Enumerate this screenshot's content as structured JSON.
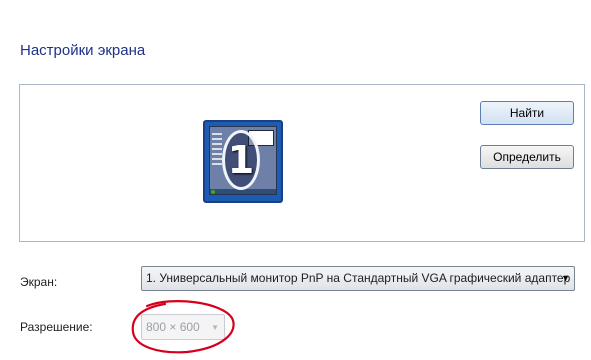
{
  "header": {
    "title": "Настройки экрана"
  },
  "preview": {
    "monitor_number": "1",
    "find_button": "Найти",
    "identify_button": "Определить"
  },
  "display": {
    "label": "Экран:",
    "selected": "1. Универсальный монитор PnP на Стандартный VGA графический адаптер"
  },
  "resolution": {
    "label": "Разрешение:",
    "selected": "800 × 600",
    "enabled": false
  },
  "colors": {
    "title": "#1e3287",
    "monitor": "#1d5cb3",
    "annotation": "#d6001c"
  },
  "icons": {
    "dropdown_arrow": "chevron-down-icon"
  }
}
